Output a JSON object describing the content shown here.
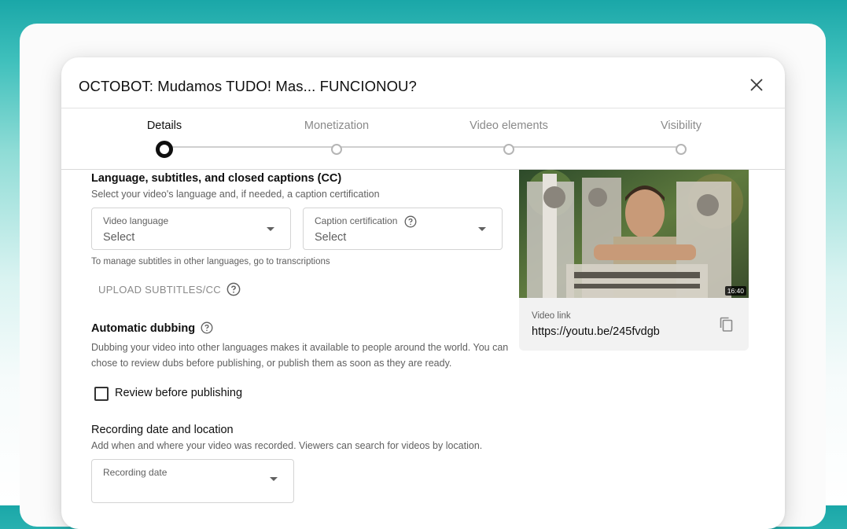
{
  "dialog": {
    "title": "OCTOBOT: Mudamos TUDO! Mas... FUNCIONOU?"
  },
  "stepper": {
    "steps": [
      {
        "label": "Details",
        "active": true
      },
      {
        "label": "Monetization",
        "active": false
      },
      {
        "label": "Video elements",
        "active": false
      },
      {
        "label": "Visibility",
        "active": false
      }
    ]
  },
  "language_section": {
    "title": "Language, subtitles, and closed captions (CC)",
    "subtitle": "Select your video's language and, if needed, a caption certification",
    "video_language": {
      "label": "Video language",
      "value": "Select"
    },
    "caption_certification": {
      "label": "Caption certification",
      "value": "Select"
    },
    "manage_note": "To manage subtitles in other languages, go to transcriptions",
    "upload_label": "UPLOAD SUBTITLES/CC"
  },
  "dubbing_section": {
    "title": "Automatic dubbing",
    "description_line1": "Dubbing your video into other languages makes it available to people around the world. You can",
    "description_line2": "chose to review dubs before publishing, or publish them as soon as they are ready.",
    "review_label": "Review before publishing",
    "review_checked": false
  },
  "recording_section": {
    "title": "Recording date and location",
    "subtitle": "Add when and where your video was recorded. Viewers can search for videos by location.",
    "recording_date": {
      "label": "Recording date"
    }
  },
  "video_card": {
    "duration": "16:40",
    "link_label": "Video link",
    "link_url": "https://youtu.be/245fvdgb"
  },
  "colors": {
    "background_top": "#1aa7a8",
    "text_primary": "#0f0f0f",
    "text_secondary": "#606060"
  }
}
